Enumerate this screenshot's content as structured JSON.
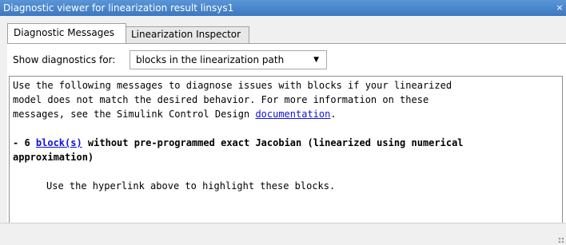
{
  "window": {
    "title": "Diagnostic viewer for linearization result linsys1",
    "close_glyph": "×"
  },
  "tabs": [
    {
      "label": "Diagnostic Messages",
      "active": true
    },
    {
      "label": "Linearization Inspector",
      "active": false
    }
  ],
  "filter": {
    "label": "Show diagnostics for:",
    "selected": "blocks in the linearization path",
    "arrow_glyph": "▼"
  },
  "messages": {
    "intro_line1": "Use the following messages to diagnose issues with blocks if your linearized",
    "intro_line2": "model does not match the desired behavior. For more information on these",
    "intro_line3_prefix": "messages, see the Simulink Control Design ",
    "intro_link": "documentation",
    "intro_line3_suffix": ".",
    "item_prefix": "- 6 ",
    "item_link": "block(s)",
    "item_suffix": " without pre-programmed exact Jacobian (linearized using numerical",
    "item_line2": "approximation)",
    "hint": "Use the hyperlink above to highlight these blocks."
  },
  "colors": {
    "titlebar": "#3b78c2",
    "link": "#1010e0",
    "background": "#f0f0f0"
  }
}
